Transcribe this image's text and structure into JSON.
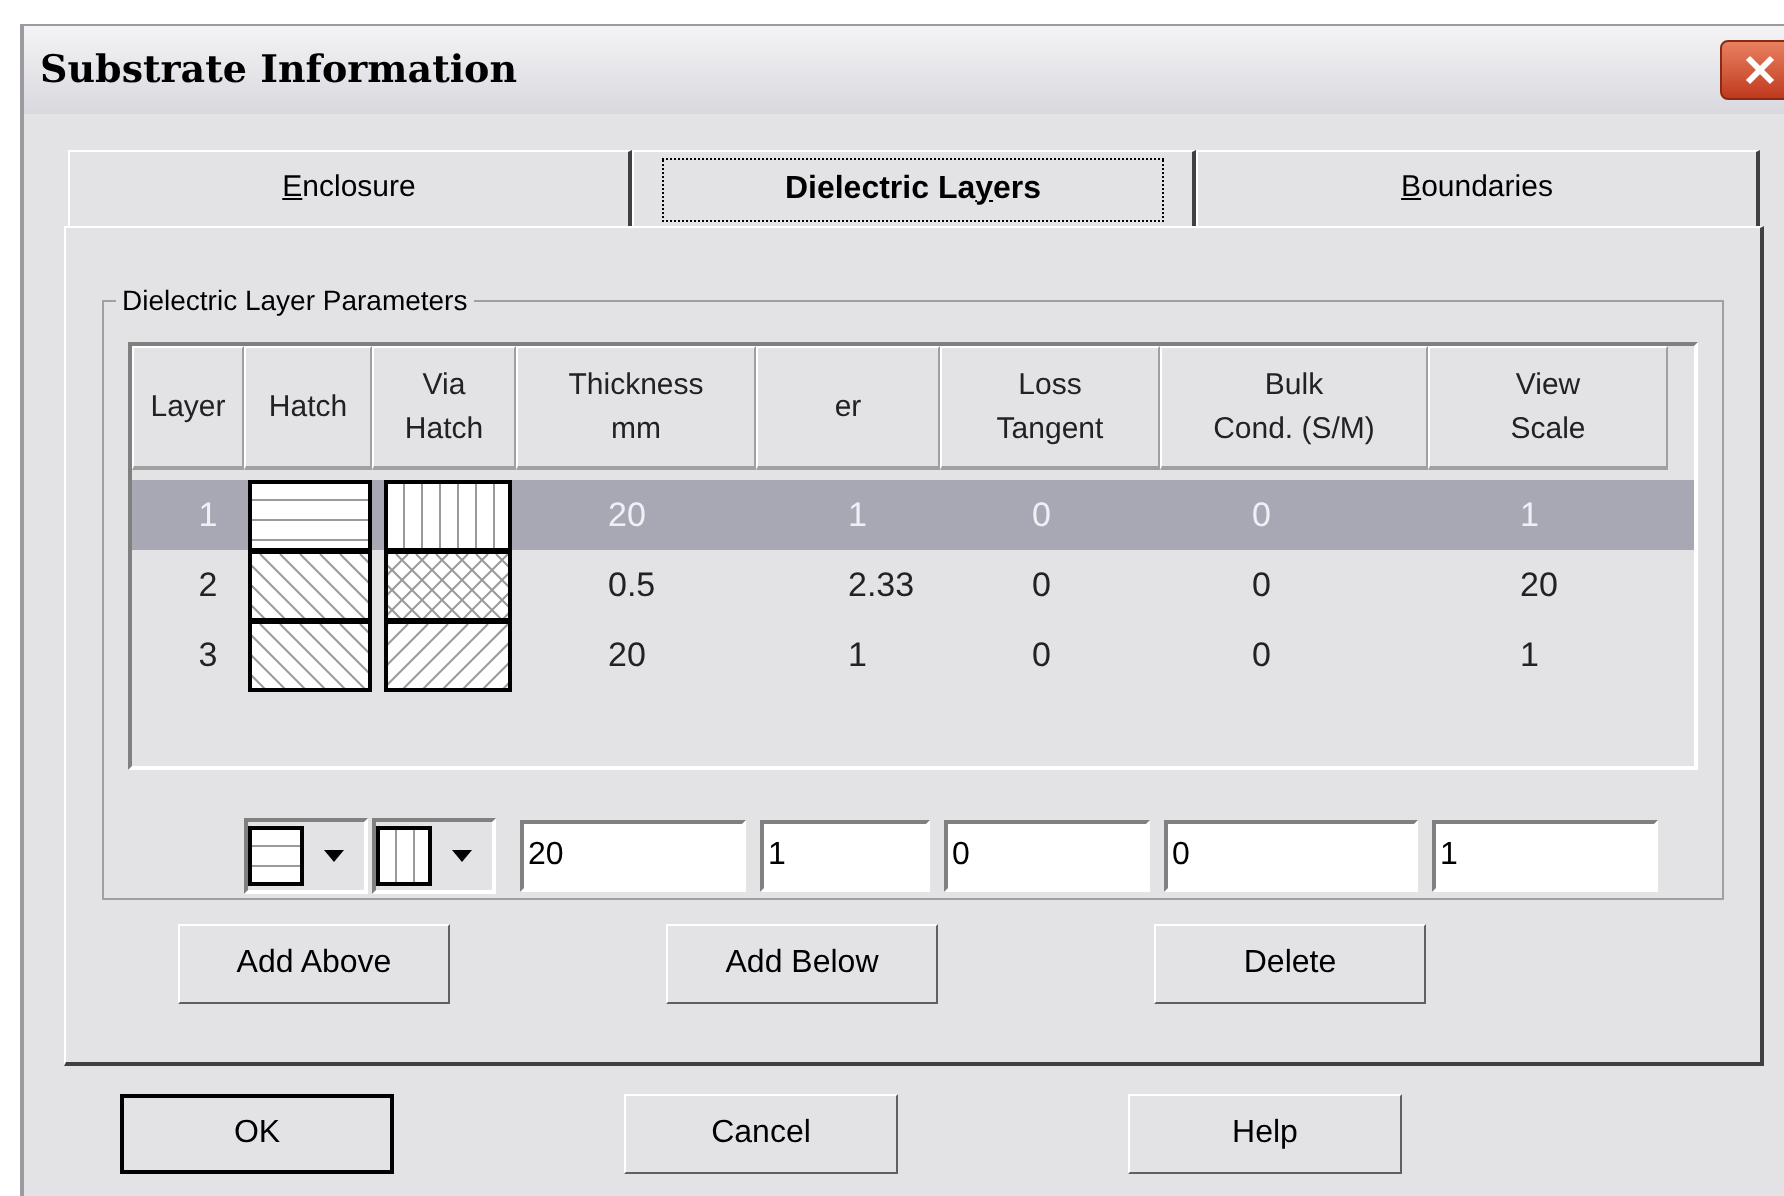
{
  "window": {
    "title": "Substrate Information"
  },
  "tabs": [
    {
      "key": "E",
      "post": "nclosure",
      "selected": false
    },
    {
      "pre": "Dielectric La",
      "key": "y",
      "post": "ers",
      "selected": true
    },
    {
      "key": "B",
      "post": "oundaries",
      "selected": false
    }
  ],
  "group": {
    "title": "Dielectric Layer Parameters"
  },
  "table": {
    "columns": [
      [
        "Layer"
      ],
      [
        "Hatch"
      ],
      [
        "Via",
        "Hatch"
      ],
      [
        "Thickness",
        "mm"
      ],
      [
        "er"
      ],
      [
        "Loss",
        "Tangent"
      ],
      [
        "Bulk",
        "Cond. (S/M)"
      ],
      [
        "View",
        "Scale"
      ]
    ],
    "rows": [
      {
        "layer": "1",
        "hatch": {
          "kind": "horizontal"
        },
        "via_hatch": {
          "kind": "vertical"
        },
        "thickness": "20",
        "er": "1",
        "loss": "0",
        "bulk": "0",
        "scale": "1",
        "selected": true
      },
      {
        "layer": "2",
        "hatch": {
          "kind": "diagonal_down"
        },
        "via_hatch": {
          "kind": "cross"
        },
        "thickness": "0.5",
        "er": "2.33",
        "loss": "0",
        "bulk": "0",
        "scale": "20",
        "selected": false
      },
      {
        "layer": "3",
        "hatch": {
          "kind": "diagonal_down"
        },
        "via_hatch": {
          "kind": "diagonal_up"
        },
        "thickness": "20",
        "er": "1",
        "loss": "0",
        "bulk": "0",
        "scale": "1",
        "selected": false
      }
    ]
  },
  "editor": {
    "hatch": {
      "kind": "horizontal"
    },
    "via_hatch": {
      "kind": "vertical"
    },
    "values": [
      "20",
      "1",
      "0",
      "0",
      "1"
    ]
  },
  "row_buttons": [
    "Add Above",
    "Add Below",
    "Delete"
  ],
  "dialog_buttons": [
    {
      "label": "OK",
      "default": true
    },
    {
      "label": "Cancel",
      "default": false
    },
    {
      "label": "Help",
      "default": false
    }
  ]
}
